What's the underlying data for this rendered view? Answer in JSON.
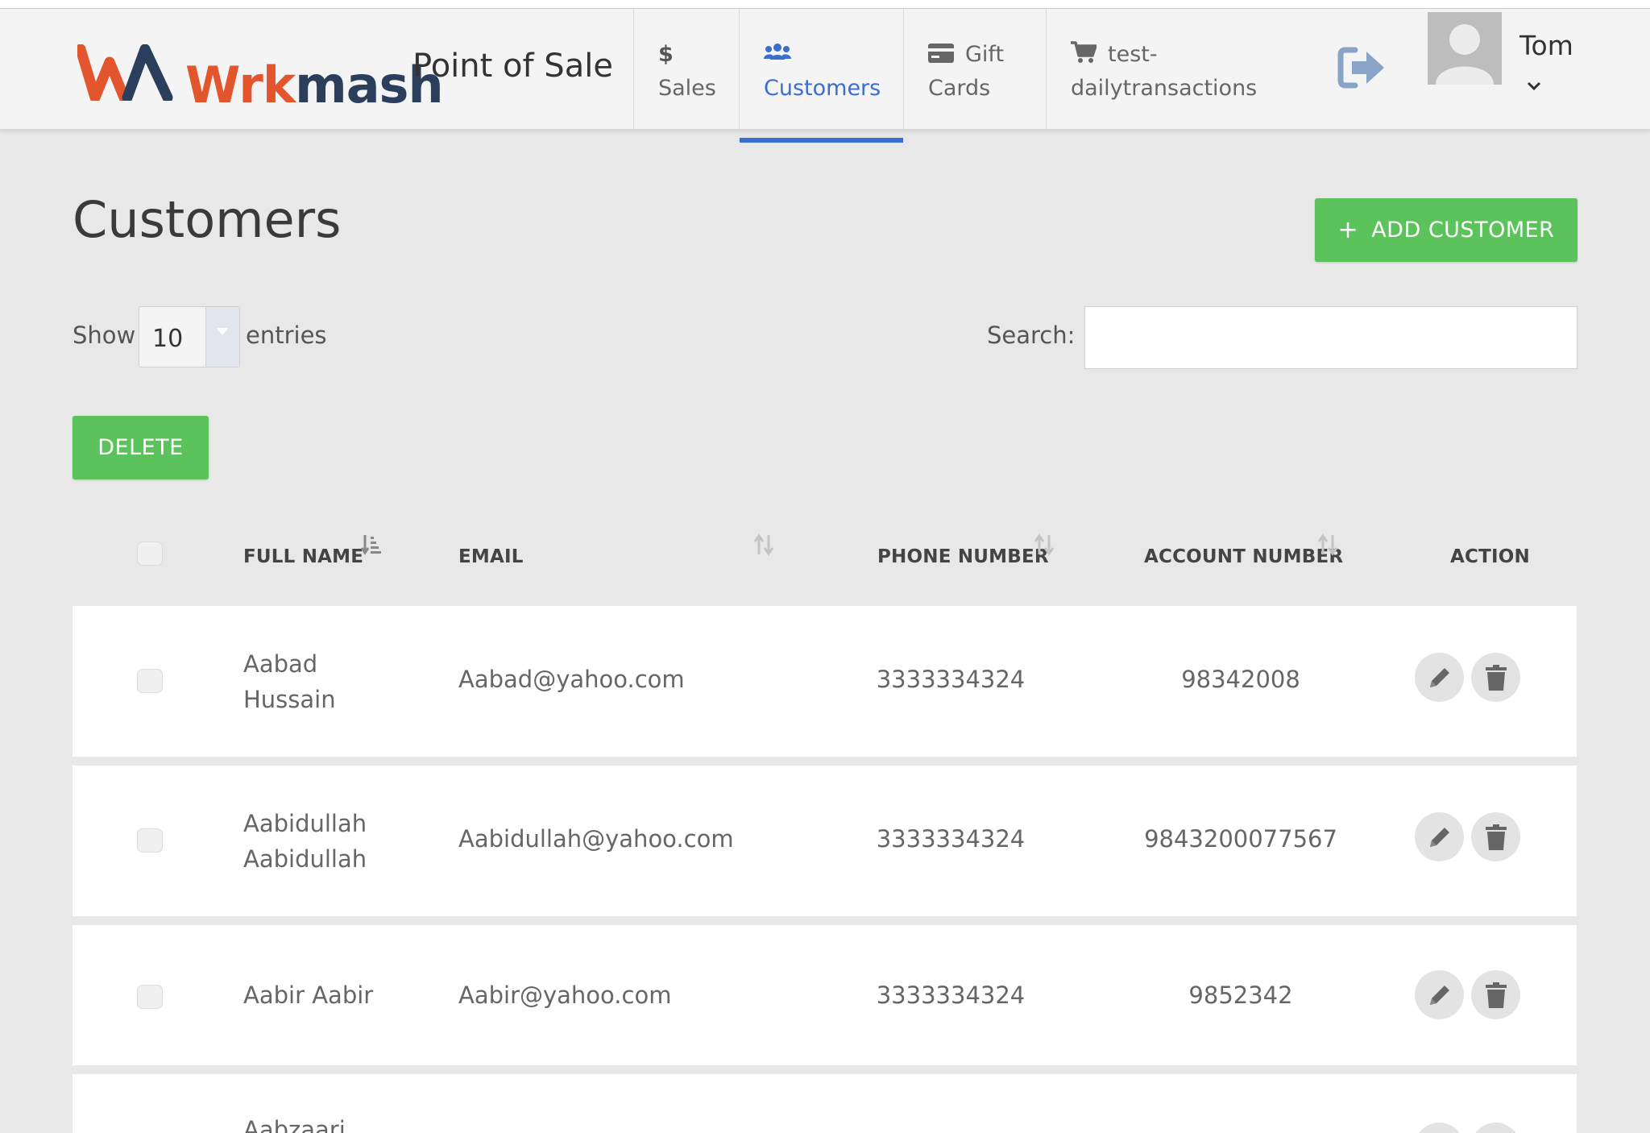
{
  "header": {
    "logo_word_1": "Wrk",
    "logo_word_2": "mash",
    "app_title": "Point of Sale",
    "tabs": [
      {
        "id": "sales",
        "icon": "dollar-icon",
        "line1": "$",
        "line2": "Sales"
      },
      {
        "id": "customers",
        "icon": "users-icon",
        "line1": "",
        "line2": "Customers",
        "active": true
      },
      {
        "id": "gift-cards",
        "icon": "credit-card-icon",
        "line1": "Gift",
        "line2": "Cards"
      },
      {
        "id": "daily-transactions",
        "icon": "cart-icon",
        "line1": "test-",
        "line2": "dailytransactions"
      }
    ],
    "user_name": "Tom"
  },
  "page": {
    "title": "Customers",
    "add_button": "ADD CUSTOMER",
    "show_label": "Show",
    "entries_value": "10",
    "entries_label": "entries",
    "search_label": "Search:",
    "search_value": "",
    "delete_button": "DELETE"
  },
  "table": {
    "columns": {
      "full_name": "FULL NAME",
      "email": "EMAIL",
      "phone": "PHONE NUMBER",
      "account": "ACCOUNT NUMBER",
      "action": "ACTION"
    },
    "rows": [
      {
        "name_1": "Aabad",
        "name_2": "Hussain",
        "email": "Aabad@yahoo.com",
        "phone": "3333334324",
        "account": "98342008"
      },
      {
        "name_1": "Aabidullah",
        "name_2": "Aabidullah",
        "email": "Aabidullah@yahoo.com",
        "phone": "3333334324",
        "account": "9843200077567"
      },
      {
        "name_1": "Aabir Aabir",
        "name_2": "",
        "email": "Aabir@yahoo.com",
        "phone": "3333334324",
        "account": "9852342"
      },
      {
        "name_1": "Aabzaari",
        "name_2": "",
        "email": "",
        "phone": "",
        "account": ""
      }
    ]
  },
  "colors": {
    "accent_blue": "#3b6fcf",
    "button_green": "#5cc35c",
    "logo_orange": "#e2552d",
    "logo_navy": "#2b3f5c"
  }
}
